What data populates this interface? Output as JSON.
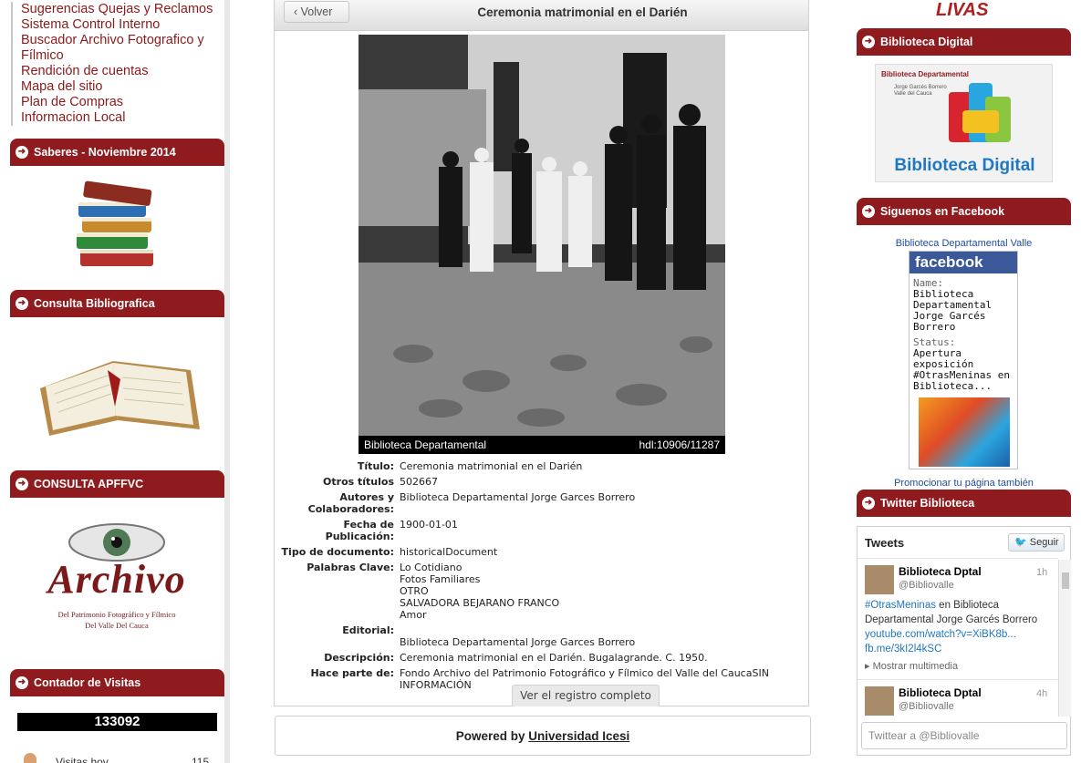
{
  "left": {
    "nav": [
      "Sugerencias Quejas y Reclamos",
      "Sistema Control Interno",
      "Buscador Archivo Fotografico y",
      "Fílmico",
      "Rendición de cuentas",
      "Mapa del sitio",
      "Plan de Compras",
      "Informacion Local"
    ],
    "sections": {
      "saberes": "Saberes - Noviembre 2014",
      "consulta_bib": "Consulta Bibliografica",
      "consulta_apffvc": "CONSULTA APFFVC",
      "contador": "Contador de Visitas"
    },
    "archivo_logo": "Archivo",
    "archivo_sub1": "Del Patrimonio Fotográfico y Fílmico",
    "archivo_sub2": "Del Valle Del Cauca",
    "counter_value": "133092",
    "visits_label": "Visitas hoy",
    "visits_value": "115"
  },
  "center": {
    "back_label": "Volver",
    "title": "Ceremonia matrimonial en el Darién",
    "photo_caption_left": "Biblioteca Departamental",
    "photo_caption_right": "hdl:10906/11287",
    "meta": [
      {
        "k": "Título:",
        "v": [
          "Ceremonia matrimonial en el Darién"
        ]
      },
      {
        "k": "Otros títulos",
        "v": [
          "502667"
        ]
      },
      {
        "k": "Autores y Colaboradores:",
        "v": [
          "Biblioteca Departamental Jorge Garces Borrero"
        ]
      },
      {
        "k": "Fecha de Publicación:",
        "v": [
          "1900-01-01"
        ]
      },
      {
        "k": "Tipo de documento:",
        "v": [
          "historicalDocument"
        ]
      },
      {
        "k": "Palabras Clave:",
        "v": [
          "Lo Cotidiano",
          "Fotos Familiares",
          "OTRO",
          "SALVADORA BEJARANO FRANCO",
          "Amor"
        ]
      },
      {
        "k": "Editorial:",
        "v": [
          "",
          "Biblioteca Departamental Jorge Garces Borrero"
        ]
      },
      {
        "k": "Descripción:",
        "v": [
          "Ceremonia matrimonial en el Darién. Bugalagrande. C. 1950."
        ]
      },
      {
        "k": "Hace parte de:",
        "v": [
          "Fondo Archivo del Patrimonio Fotográfico y Fílmico del Valle del CaucaSIN",
          "INFORMACIÓN"
        ]
      }
    ],
    "full_record": "Ver el registro completo",
    "powered_prefix": "Powered by",
    "powered_link": "Universidad Icesi"
  },
  "right": {
    "top_logo": "LIVAS",
    "sections": {
      "biblioteca_digital": "Biblioteca Digital",
      "facebook": "Siguenos en Facebook",
      "twitter": "Twitter Biblioteca"
    },
    "bd_logo_top": "Biblioteca Departamental",
    "bd_logo_sub": "Jorge Garcés Borrero\nValle del Cauca",
    "bd_logo_text": "Biblioteca Digital",
    "fb_page_link": "Biblioteca Departamental Valle",
    "fb_brand": "facebook",
    "fb_name_label": "Name:",
    "fb_name": "Biblioteca Departamental Jorge Garcés Borrero",
    "fb_status_label": "Status:",
    "fb_status": "Apertura exposición #OtrasMeninas en Biblioteca...",
    "fb_promote": "Promocionar tu página también",
    "tweets_title": "Tweets",
    "follow_label": "Seguir",
    "tweets": [
      {
        "name": "Biblioteca Dptal",
        "handle": "@Bibliovalle",
        "time": "1h",
        "text_tag": "#OtrasMeninas",
        "text": " en Biblioteca Departamental Jorge Garcés Borrero",
        "link1": "youtube.com/watch?v=XiBK8b...",
        "link2": "fb.me/3kI2l4kSC",
        "media": "Mostrar multimedia"
      },
      {
        "name": "Biblioteca Dptal",
        "handle": "@Bibliovalle",
        "time": "4h"
      }
    ],
    "tweet_input_placeholder": "Twittear a @Bibliovalle"
  }
}
